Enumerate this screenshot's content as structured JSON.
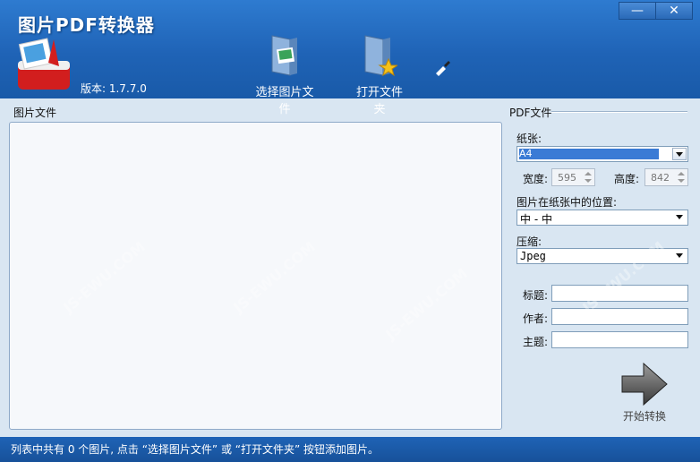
{
  "app": {
    "title": "图片PDF转换器",
    "version": "版本: 1.7.7.0"
  },
  "window_controls": {
    "minimize": "—",
    "close": "✕"
  },
  "toolbar": {
    "select_images": "选择图片文件",
    "open_folder": "打开文件夹"
  },
  "left_panel": {
    "label": "图片文件"
  },
  "right_panel": {
    "label": "PDF文件",
    "paper": {
      "label": "纸张:",
      "value": "A4"
    },
    "width": {
      "label": "宽度:",
      "value": "595"
    },
    "height": {
      "label": "高度:",
      "value": "842"
    },
    "position": {
      "label": "图片在纸张中的位置:",
      "value": "中 - 中"
    },
    "compression": {
      "label": "压缩:",
      "value": "Jpeg"
    },
    "title_field": {
      "label": "标题:",
      "value": ""
    },
    "author_field": {
      "label": "作者:",
      "value": ""
    },
    "subject_field": {
      "label": "主题:",
      "value": ""
    },
    "start_button": "开始转换"
  },
  "status_bar": {
    "text": "列表中共有 0 个图片, 点击 “选择图片文件” 或 “打开文件夹” 按钮添加图片。"
  },
  "watermarks": [
    "JS-EWU.COM",
    "JS-EWU.COM",
    "JS-EWU.COM",
    "JS-EWU.COM"
  ],
  "colors": {
    "header": "#1f63b6",
    "accent": "#3a7bd5"
  }
}
